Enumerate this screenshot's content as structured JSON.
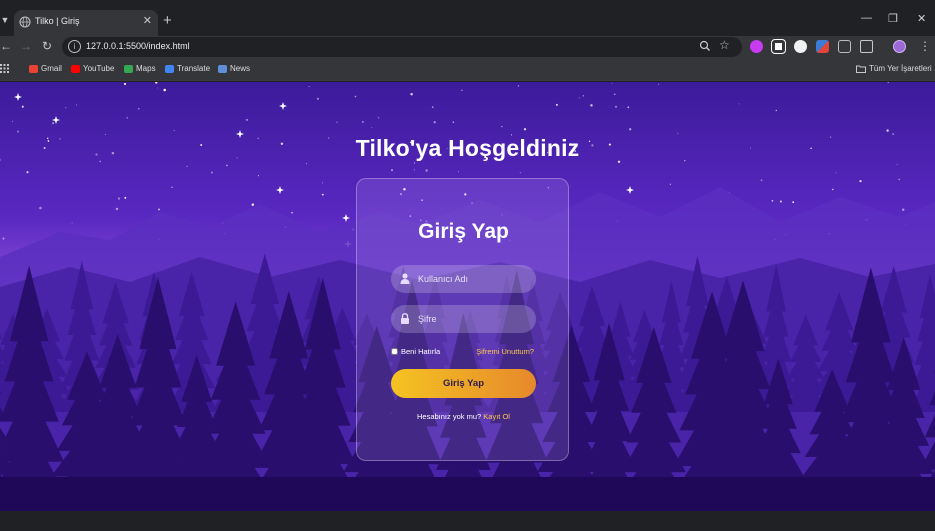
{
  "browser": {
    "tab_title": "Tilko | Giriş",
    "tab_close": "✕",
    "new_tab": "+",
    "url": "127.0.0.1:5500/index.html",
    "window_controls": {
      "minimize": "—",
      "restore": "❐",
      "close": "✕"
    },
    "bookmarks": [
      {
        "label": "Gmail",
        "icon": "gmail-icon",
        "color": "#ea4335"
      },
      {
        "label": "YouTube",
        "icon": "youtube-icon",
        "color": "#ff0000"
      },
      {
        "label": "Maps",
        "icon": "maps-icon",
        "color": "#34a853"
      },
      {
        "label": "Translate",
        "icon": "translate-icon",
        "color": "#4285f4"
      },
      {
        "label": "News",
        "icon": "news-icon",
        "color": "#5f8fd8"
      }
    ],
    "all_bookmarks": "Tüm Yer İşaretleri"
  },
  "page": {
    "heading": "Tilko'ya Hoşgeldiniz",
    "card_title": "Giriş Yap",
    "username_placeholder": "Kullanıcı Adı",
    "password_placeholder": "Şifre",
    "remember_label": "Beni Hatırla",
    "forgot_label": "Şifremi Unuttum?",
    "login_button": "Giriş Yap",
    "signup_prompt": "Hesabınız yok mu?",
    "signup_link": "Kayıt Ol"
  },
  "colors": {
    "accent_link": "#ffc64a",
    "button_gradient_start": "#f5c322",
    "button_gradient_end": "#e6892b",
    "sky_top": "#3c1b9a",
    "horizon": "#8b4fd8"
  }
}
